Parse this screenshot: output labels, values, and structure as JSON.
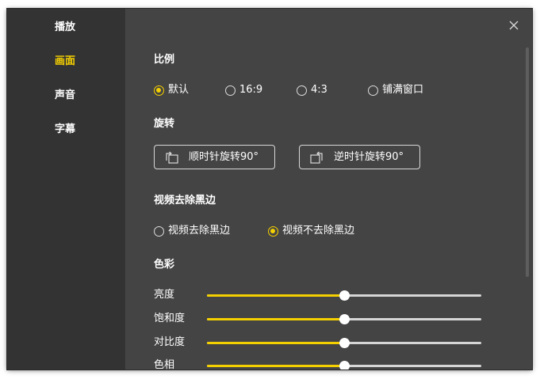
{
  "sidebar": {
    "items": [
      {
        "label": "播放",
        "active": false
      },
      {
        "label": "画面",
        "active": true
      },
      {
        "label": "声音",
        "active": false
      },
      {
        "label": "字幕",
        "active": false
      }
    ]
  },
  "close_icon": "close-icon",
  "aspect": {
    "title": "比例",
    "options": [
      {
        "label": "默认",
        "checked": true
      },
      {
        "label": "16:9",
        "checked": false
      },
      {
        "label": "4:3",
        "checked": false
      },
      {
        "label": "铺满窗口",
        "checked": false
      }
    ]
  },
  "rotate": {
    "title": "旋转",
    "clockwise_label": "顺时针旋转90°",
    "clockwise_icon": "rotate-clockwise-icon",
    "counterclockwise_label": "逆时针旋转90°",
    "counterclockwise_icon": "rotate-counterclockwise-icon"
  },
  "black_border": {
    "title": "视频去除黑边",
    "options": [
      {
        "label": "视频去除黑边",
        "checked": false
      },
      {
        "label": "视频不去除黑边",
        "checked": true
      }
    ]
  },
  "color": {
    "title": "色彩",
    "sliders": [
      {
        "label": "亮度",
        "value_fraction": 0.5
      },
      {
        "label": "饱和度",
        "value_fraction": 0.5
      },
      {
        "label": "对比度",
        "value_fraction": 0.5
      },
      {
        "label": "色相",
        "value_fraction": 0.5
      }
    ]
  },
  "colors": {
    "accent": "#f5d000",
    "sidebar_bg": "#333333",
    "panel_bg": "#444444",
    "text": "#ffffff"
  }
}
